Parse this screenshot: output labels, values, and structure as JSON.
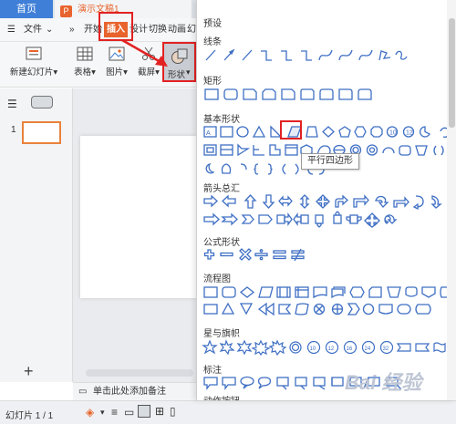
{
  "tabs": {
    "home": "首页",
    "doc_icon": "P",
    "doc_title": "演示文稿1"
  },
  "menu": {
    "file": "文件",
    "start": "开始",
    "insert": "插入",
    "design": "设计",
    "transition": "切换",
    "animation": "动画",
    "more": "幻"
  },
  "ribbon": {
    "new_slide": "新建幻灯片",
    "table": "表格",
    "image": "图片",
    "screenshot": "截屏",
    "shape": "形状"
  },
  "slides": {
    "first_number": "1"
  },
  "notes": {
    "placeholder": "单击此处添加备注"
  },
  "status": {
    "slide_counter": "幻灯片 1 / 1"
  },
  "dropdown": {
    "header": "预设",
    "sections": [
      "线条",
      "矩形",
      "基本形状",
      "箭头总汇",
      "公式形状",
      "流程图",
      "星与旗帜",
      "标注",
      "动作按钮"
    ],
    "tooltip": "平行四边形"
  },
  "watermark": "Bai 经验",
  "colors": {
    "accent": "#e8642c",
    "highlight": "#e22222",
    "shape_stroke": "#3f6fc4",
    "home_tab": "#3f7fd8"
  }
}
